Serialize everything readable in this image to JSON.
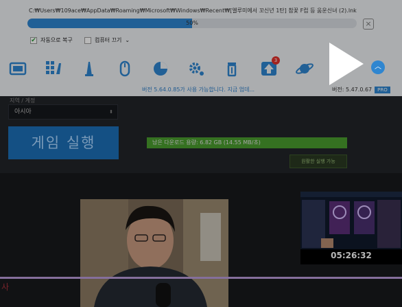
{
  "task": {
    "path": "C:₩Users₩109ace₩AppData₩Roaming₩Microsoft₩Windows₩Recent₩[엘루미에서 꼬신년 1탄] 참꽃 F컵 등 움운신녀 (2).lnk",
    "progress_percent": 50,
    "progress_label": "50%",
    "close_glyph": "×"
  },
  "options": {
    "auto_recover": "자동으로 복구",
    "shutdown": "컴퓨터 끄기",
    "shutdown_caret": "⌄"
  },
  "toolbar": {
    "items": [
      {
        "icon": "screen-icon"
      },
      {
        "icon": "grid-clean-icon"
      },
      {
        "icon": "broom-icon"
      },
      {
        "icon": "mouse-icon"
      },
      {
        "icon": "pie-chart-icon"
      },
      {
        "icon": "gear-icon"
      },
      {
        "icon": "trash-icon"
      },
      {
        "icon": "update-icon",
        "badge": "3"
      },
      {
        "icon": "planet-icon"
      }
    ],
    "scroll_up_glyph": "︿"
  },
  "version": {
    "update_notice": "버전 5.64.0.85가 사용 가능합니다. 지금 업데...",
    "current": "버전: 5.47.0.67",
    "pro": "PRO"
  },
  "launcher": {
    "region_label": "지역 / 계정",
    "region_value": "아시아",
    "play_label": "게임 실행",
    "download_text": "남은 다운로드 용량: 6.82 GB (14.55 MB/초)",
    "download_progress_percent": 100,
    "playable_label": "원활한 실행 가능"
  },
  "stream": {
    "thumb_time": "05:26:32",
    "side_char": "사"
  },
  "colors": {
    "accent": "#2f86d0",
    "download_green": "#4a9d2e",
    "purple_line": "#b99ad8"
  }
}
